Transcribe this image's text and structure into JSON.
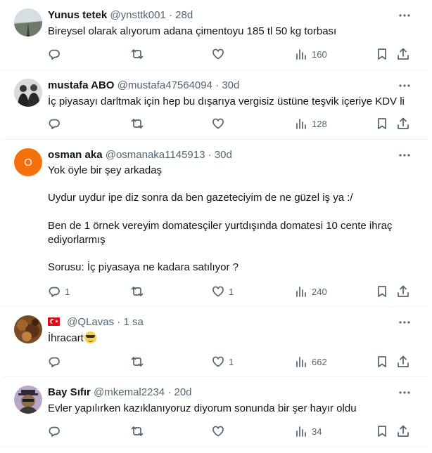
{
  "tweets": [
    {
      "name": "Yunus tetek",
      "handle": "@ynsttk001",
      "dot": "·",
      "time": "28d",
      "text": "Bireysel olarak alıyorum adana çimentoyu 185 tl 50 kg torbası",
      "replies": "",
      "retweets": "",
      "likes": "",
      "views": "160"
    },
    {
      "name": "mustafa ABO",
      "handle": "@mustafa47564094",
      "dot": "·",
      "time": "30d",
      "text": "İç piyasayı darltmak için hep bu dışarıya vergisiz üstüne teşvik içeriye KDV li",
      "replies": "",
      "retweets": "",
      "likes": "",
      "views": "128"
    },
    {
      "name": "osman aka",
      "handle": "@osmanaka1145913",
      "dot": "·",
      "time": "30d",
      "avatar_letter": "O",
      "text": "Yok öyle bir şey arkadaş\n\nUydur uydur ipe diz sonra da ben gazeteciyim de ne güzel iş ya :/\n\nBen de 1 örnek vereyim domatesçiler yurtdışında domatesi 10 cente ihraç ediyorlarmış\n\nSorusu: İç piyasaya ne kadara satılıyor ?",
      "replies": "1",
      "retweets": "",
      "likes": "1",
      "views": "240"
    },
    {
      "name": "",
      "handle": "@QLavas",
      "dot": "·",
      "time": "1 sa",
      "text": "İhracart",
      "replies": "",
      "retweets": "",
      "likes": "1",
      "views": "662"
    },
    {
      "name": "Bay Sıfır",
      "handle": "@mkemal2234",
      "dot": "·",
      "time": "20d",
      "text": "Evler yapılırken kazıklanıyoruz diyorum sonunda bir şer hayır oldu",
      "replies": "",
      "retweets": "",
      "likes": "",
      "views": "34"
    }
  ],
  "icons": {
    "reply": "reply-icon",
    "retweet": "retweet-icon",
    "like": "heart-icon",
    "views": "views-icon",
    "bookmark": "bookmark-icon",
    "share": "share-icon",
    "more": "more-icon"
  },
  "colors": {
    "text": "#0f1419",
    "secondary": "#536471",
    "divider": "#eff3f4",
    "osman_avatar": "#f4700c"
  }
}
